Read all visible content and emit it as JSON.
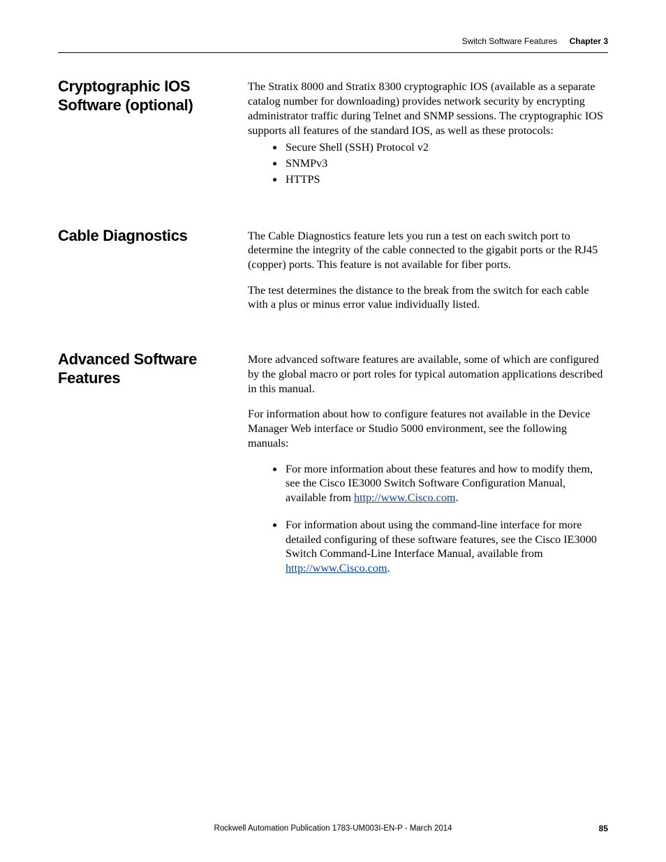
{
  "header": {
    "breadcrumb": "Switch Software Features",
    "chapter": "Chapter 3"
  },
  "sections": {
    "crypto": {
      "heading": "Cryptographic IOS Software (optional)",
      "para1": "The Stratix 8000 and Stratix 8300 cryptographic IOS (available as a separate catalog number for downloading) provides network security by encrypting administrator traffic during Telnet and SNMP sessions. The cryptographic IOS supports all features of the standard IOS, as well as these protocols:",
      "bullets": [
        "Secure Shell (SSH) Protocol v2",
        "SNMPv3",
        "HTTPS"
      ]
    },
    "cable": {
      "heading": "Cable Diagnostics",
      "para1": "The Cable Diagnostics feature lets you run a test on each switch port to determine the integrity of the cable connected to the gigabit ports or the RJ45 (copper) ports. This feature is not available for fiber ports.",
      "para2": "The test determines the distance to the break from the switch for each cable with a plus or minus error value individually listed."
    },
    "advanced": {
      "heading": "Advanced Software Features",
      "para1": "More advanced software features are available, some of which are configured by the global macro or port roles for typical automation applications described in this manual.",
      "para2": "For information about how to configure features not available in the Device Manager Web interface or Studio 5000 environment, see the following manuals:",
      "b1_pre": "For more information about these features and how to modify them, see the Cisco IE3000 Switch Software Configuration Manual, available from ",
      "b1_link": "http://www.Cisco.com",
      "b1_post": ".",
      "b2_pre": "For information about using the command-line interface for more detailed configuring of these software features, see the Cisco IE3000 Switch Command-Line Interface Manual, available from ",
      "b2_link": "http://www.Cisco.com",
      "b2_post": "."
    }
  },
  "footer": {
    "publication": "Rockwell Automation Publication 1783-UM003I-EN-P - March 2014",
    "page": "85"
  }
}
